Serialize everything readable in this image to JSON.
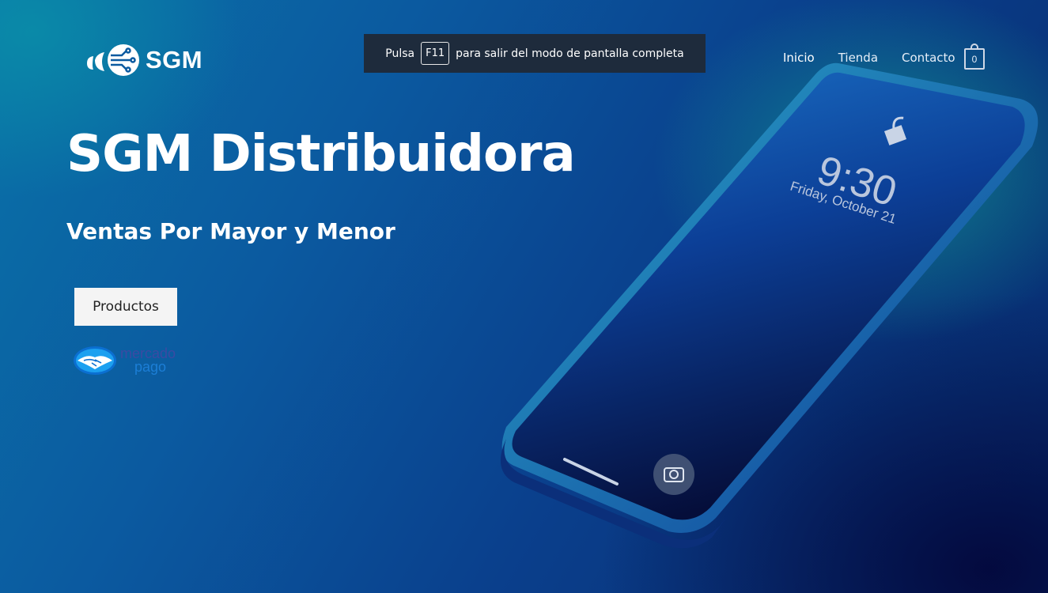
{
  "brand": {
    "name": "SGM"
  },
  "fullscreen_banner": {
    "prefix": "Pulsa",
    "key": "F11",
    "suffix": "para salir del modo de pantalla completa"
  },
  "nav": {
    "items": [
      {
        "label": "Inicio",
        "active": true
      },
      {
        "label": "Tienda"
      },
      {
        "label": "Contacto"
      }
    ],
    "cart_count": "0"
  },
  "hero": {
    "title": "SGM Distribuidora",
    "subtitle": "Ventas Por Mayor y Menor",
    "button_label": "Productos"
  },
  "payment": {
    "line1": "mercado",
    "line2": "pago"
  },
  "phone": {
    "time": "9:30",
    "date": "Friday, October 21"
  },
  "colors": {
    "accent": "#0b5aa0",
    "banner_bg": "#1e2b3c",
    "button_bg": "#f4f4f4"
  },
  "icons": [
    "logo-icon",
    "cart-icon",
    "handshake-icon",
    "lock-icon",
    "camera-icon"
  ]
}
